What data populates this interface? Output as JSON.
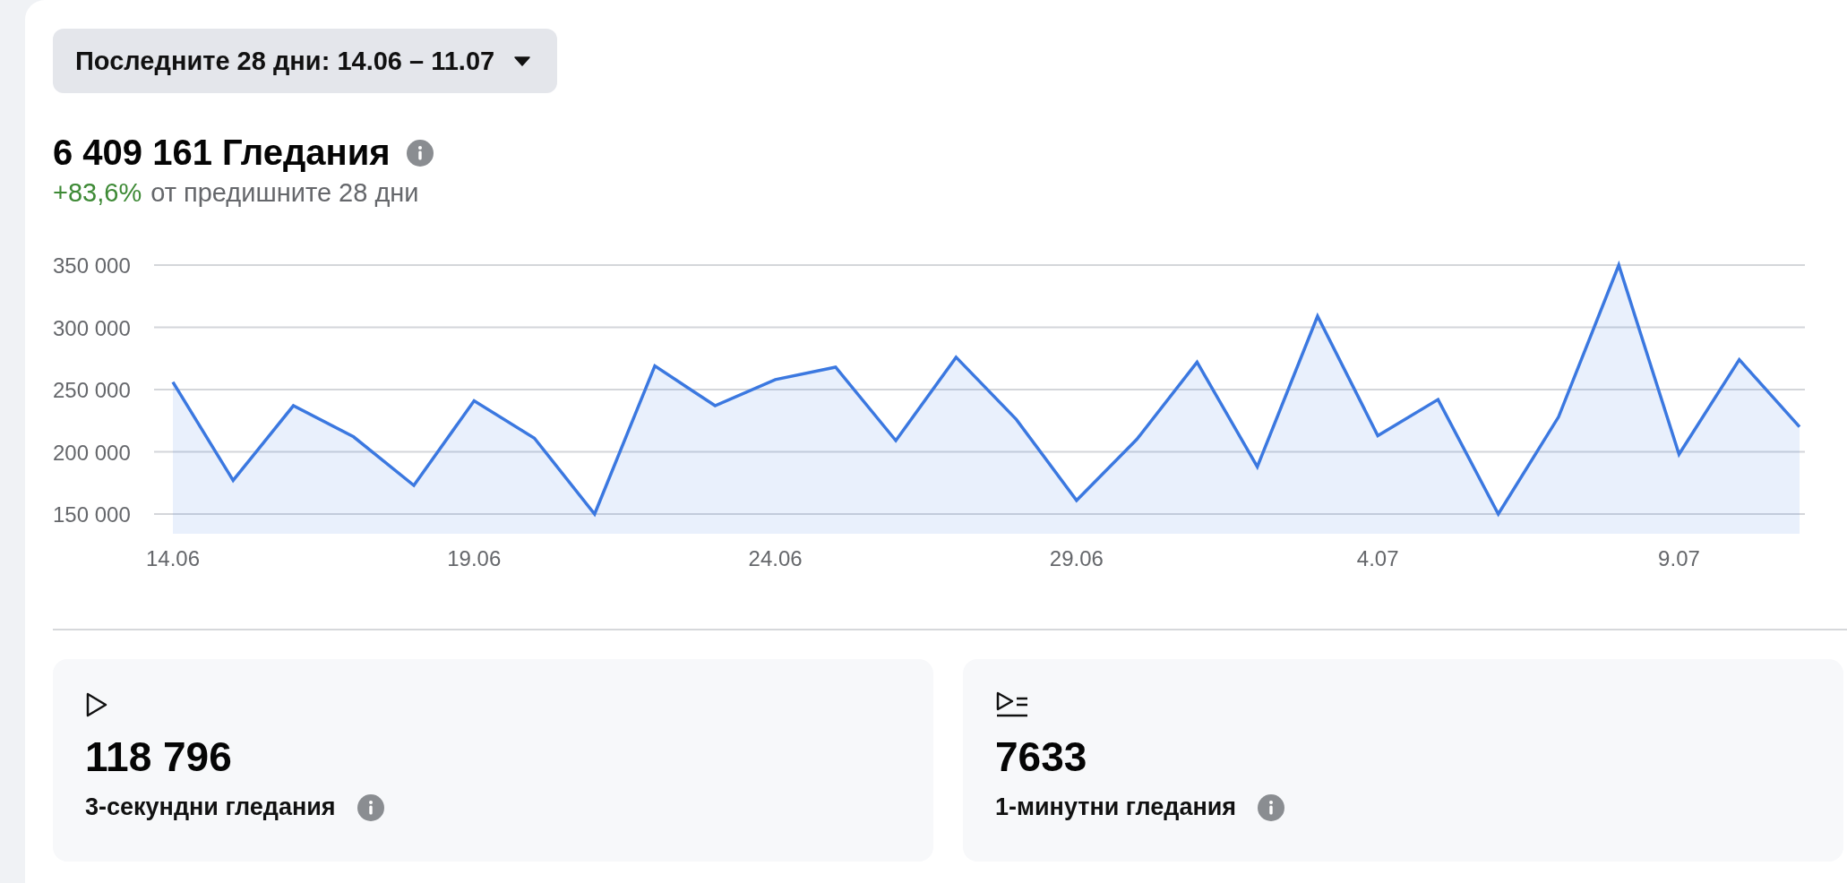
{
  "date_range": {
    "label": "Последните 28 дни: 14.06 – 11.07"
  },
  "summary": {
    "title": "6 409 161 Гледания",
    "change": "+83,6%",
    "comparison": "от предишните 28 дни"
  },
  "chart": {
    "chart_data": {
      "type": "area",
      "categories": [
        "14.06",
        null,
        null,
        null,
        null,
        "19.06",
        null,
        null,
        null,
        null,
        "24.06",
        null,
        null,
        null,
        null,
        "29.06",
        null,
        null,
        null,
        null,
        "4.07",
        null,
        null,
        null,
        null,
        "9.07",
        null,
        null
      ],
      "series": [
        {
          "color": "#3b78e0",
          "values": [
            256000,
            177000,
            237000,
            212000,
            173000,
            241000,
            211000,
            150000,
            269000,
            237000,
            258000,
            268000,
            209000,
            276000,
            226000,
            161000,
            210000,
            272000,
            188000,
            309000,
            213000,
            242000,
            150000,
            228000,
            350000,
            198000,
            274000,
            220000
          ]
        }
      ],
      "ylim": [
        150000,
        350000
      ],
      "grid": true,
      "yticks": [
        {
          "value": 150000,
          "label": "150 000"
        },
        {
          "value": 200000,
          "label": "200 000"
        },
        {
          "value": 250000,
          "label": "250 000"
        },
        {
          "value": 300000,
          "label": "300 000"
        },
        {
          "value": 350000,
          "label": "350 000"
        }
      ]
    }
  },
  "metrics": [
    {
      "kind": "play",
      "value": "118 796",
      "label": "3-секундни гледания"
    },
    {
      "kind": "queue",
      "value": "7633",
      "label": "1-минутни гледания"
    }
  ]
}
